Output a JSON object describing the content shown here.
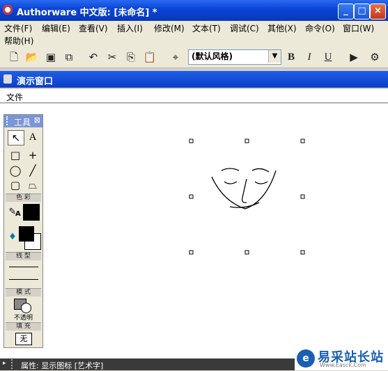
{
  "window": {
    "title": "Authorware 中文版: [未命名] *",
    "minimize": "_",
    "maximize": "□",
    "close": "×"
  },
  "menubar": {
    "items": [
      "文件(F)",
      "编辑(E)",
      "查看(V)",
      "插入(I)",
      "修改(M)",
      "文本(T)",
      "调试(C)",
      "其他(X)",
      "命令(O)",
      "窗口(W)"
    ],
    "help": "帮助(H)"
  },
  "toolbar": {
    "style_value": "(默认风格)",
    "bold": "B",
    "italic": "I",
    "underline": "U"
  },
  "presentation": {
    "title": "演示窗口",
    "menu_file": "文件"
  },
  "palette": {
    "title": "工具",
    "color_label": "色 彩",
    "line_label": "线 型",
    "mode_label": "模 式",
    "mode_value": "不透明",
    "fill_label": "填 充",
    "fill_value": "无"
  },
  "statusbar": {
    "text": "属性: 显示图标 [艺术字]"
  },
  "watermark": {
    "name": "易采站长站",
    "url": "Www.Easck.Com"
  },
  "colors": {
    "titlebar": "#0a46d8",
    "panel": "#ece9d8",
    "status": "#3a3a3a"
  }
}
